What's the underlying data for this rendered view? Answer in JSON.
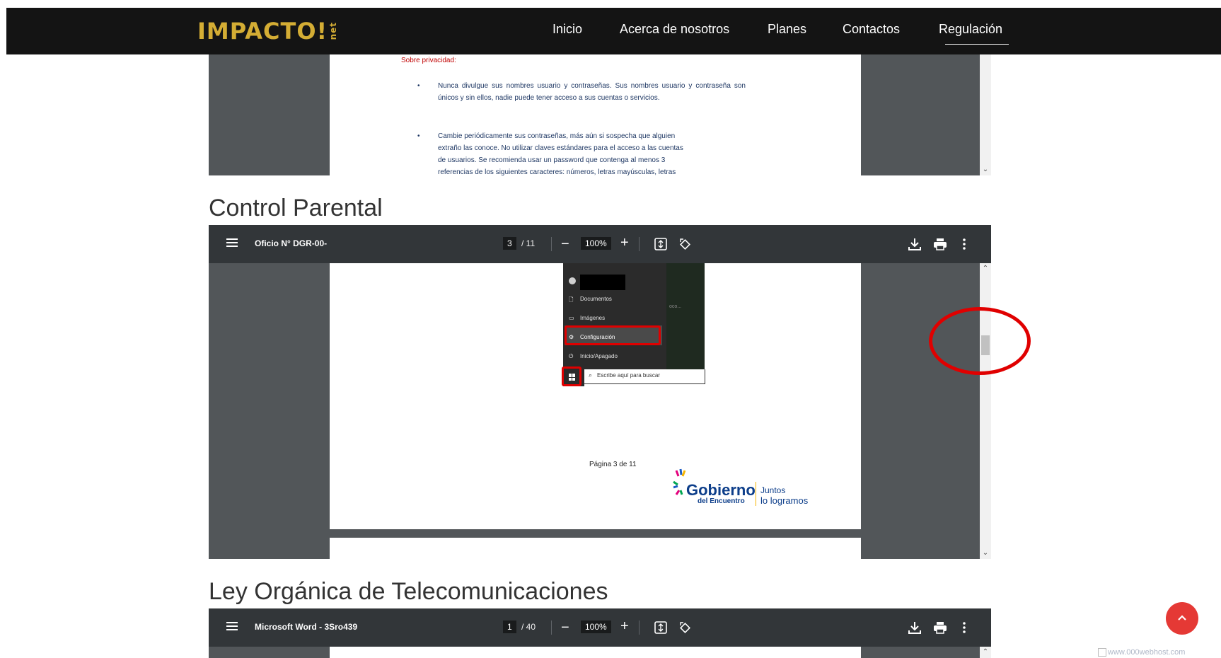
{
  "nav": {
    "logo_main": "IMPACTO!",
    "logo_sub": "net",
    "links": [
      "Inicio",
      "Acerca de nosotros",
      "Planes",
      "Contactos",
      "Regulación"
    ],
    "active_link": "Regulación"
  },
  "privacy_doc": {
    "heading": "Sobre privacidad:",
    "bullet1": "Nunca divulgue sus nombres usuario y contraseñas. Sus nombres usuario y contraseña son únicos y sin ellos, nadie puede tener acceso a sus cuentas o servicios.",
    "bullet2_l1": "Cambie periódicamente sus contraseñas, más aún si sospecha que alguien",
    "bullet2_l2": "extraño las conoce. No utilizar claves estándares para el acceso a las cuentas",
    "bullet2_l3": "de usuarios. Se recomienda usar un password que contenga al menos 3",
    "bullet2_l4": "referencias de los siguientes caracteres: números, letras mayúsculas, letras"
  },
  "section_parental": {
    "title": "Control Parental",
    "pdf": {
      "doc_title": "Oficio N° DGR-00-",
      "page": "3",
      "total": "/ 11",
      "zoom": "100%"
    },
    "menu": {
      "items": [
        "Documentos",
        "Imágenes",
        "Configuración",
        "Inicio/Apagado"
      ],
      "search_placeholder": "Escribe aquí para buscar",
      "dim_text": "oco..."
    },
    "footer_page": "Página 3 de 11",
    "logo_gobierno": "Gobierno",
    "logo_encuentro": "del Encuentro",
    "logo_juntos": "Juntos",
    "logo_logramos": "lo logramos"
  },
  "section_ley": {
    "title": "Ley Orgánica de Telecomunicaciones",
    "pdf": {
      "doc_title": "Microsoft Word - 3Sro439",
      "page": "1",
      "total": "/ 40",
      "zoom": "100%"
    }
  },
  "corner_badge": "www.000webhost.com",
  "colors": {
    "navbar": "#141414",
    "logo": "#d4ad34",
    "pdf_toolbar": "#323639",
    "pdf_bg": "#525659",
    "annotation_red": "#e00000",
    "back_to_top": "#e53935"
  },
  "icons": [
    "menu-icon",
    "download-icon",
    "print-icon",
    "more-vert-icon",
    "fit-page-icon",
    "rotate-icon",
    "chevron-up-icon"
  ]
}
